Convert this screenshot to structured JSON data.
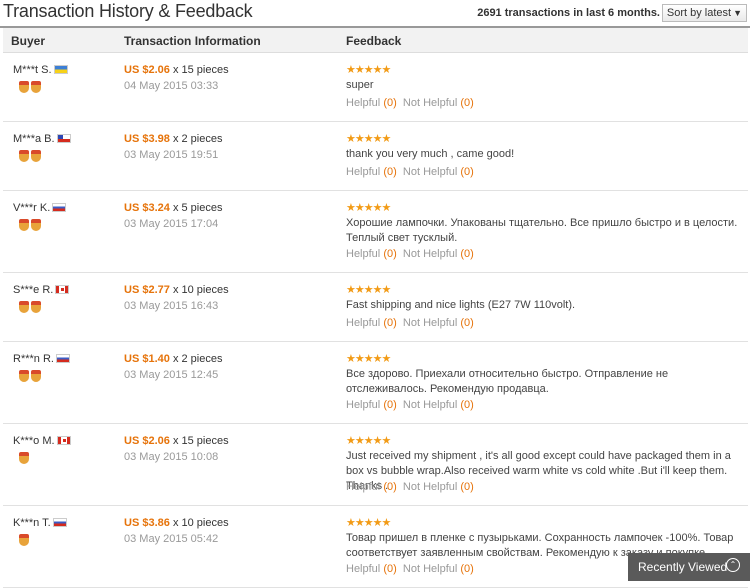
{
  "header": {
    "title": "Transaction History & Feedback",
    "tx_count": "2691 transactions in last 6 months.",
    "sort_label": "Sort by latest"
  },
  "columns": {
    "buyer": "Buyer",
    "transaction": "Transaction Information",
    "feedback": "Feedback"
  },
  "rows": [
    {
      "buyer": "M***t S.",
      "flag": "ua",
      "medals": 2,
      "price": "US $2.06",
      "qty": "x 15 pieces",
      "date": "04 May 2015 03:33",
      "stars": "★★★★★",
      "comment": "super",
      "helpful_label": "Helpful",
      "helpful": "(0)",
      "not_helpful_label": "Not Helpful",
      "not_helpful": "(0)"
    },
    {
      "buyer": "M***a B.",
      "flag": "cl",
      "medals": 2,
      "price": "US $3.98",
      "qty": "x 2 pieces",
      "date": "03 May 2015 19:51",
      "stars": "★★★★★",
      "comment": "thank you very much , came good!",
      "helpful_label": "Helpful",
      "helpful": "(0)",
      "not_helpful_label": "Not Helpful",
      "not_helpful": "(0)"
    },
    {
      "buyer": "V***r K.",
      "flag": "ru",
      "medals": 2,
      "price": "US $3.24",
      "qty": "x 5 pieces",
      "date": "03 May 2015 17:04",
      "stars": "★★★★★",
      "comment": "Хорошие лампочки. Упакованы тщательно. Все пришло быстро и в целости. Теплый свет тусклый.",
      "helpful_label": "Helpful",
      "helpful": "(0)",
      "not_helpful_label": "Not Helpful",
      "not_helpful": "(0)"
    },
    {
      "buyer": "S***e R.",
      "flag": "ca",
      "medals": 2,
      "price": "US $2.77",
      "qty": "x 10 pieces",
      "date": "03 May 2015 16:43",
      "stars": "★★★★★",
      "comment": "Fast shipping and nice lights (E27 7W 110volt).",
      "helpful_label": "Helpful",
      "helpful": "(0)",
      "not_helpful_label": "Not Helpful",
      "not_helpful": "(0)"
    },
    {
      "buyer": "R***n R.",
      "flag": "ru",
      "medals": 2,
      "price": "US $1.40",
      "qty": "x 2 pieces",
      "date": "03 May 2015 12:45",
      "stars": "★★★★★",
      "comment": "Все здорово. Приехали относительно быстро. Отправление не отслеживалось. Рекомендую продавца.",
      "helpful_label": "Helpful",
      "helpful": "(0)",
      "not_helpful_label": "Not Helpful",
      "not_helpful": "(0)"
    },
    {
      "buyer": "K***o M.",
      "flag": "ca",
      "medals": 1,
      "price": "US $2.06",
      "qty": "x 15 pieces",
      "date": "03 May 2015 10:08",
      "stars": "★★★★★",
      "comment": "Just received my shipment , it's all good except could have packaged them in a box vs bubble wrap.Also received warm white vs cold white .But i'll keep them. Thanks .",
      "helpful_label": "Helpful",
      "helpful": "(0)",
      "not_helpful_label": "Not Helpful",
      "not_helpful": "(0)"
    },
    {
      "buyer": "K***n T.",
      "flag": "ru",
      "medals": 1,
      "price": "US $3.86",
      "qty": "x 10 pieces",
      "date": "03 May 2015 05:42",
      "stars": "★★★★★",
      "comment": "Товар пришел в пленке с пузырьками. Сохранность лампочек -100%. Товар соответствует заявленным свойствам. Рекомендую к заказу и покупке.",
      "helpful_label": "Helpful",
      "helpful": "(0)",
      "not_helpful_label": "Not Helpful",
      "not_helpful": "(0)"
    }
  ],
  "recently_viewed": "Recently Viewed"
}
